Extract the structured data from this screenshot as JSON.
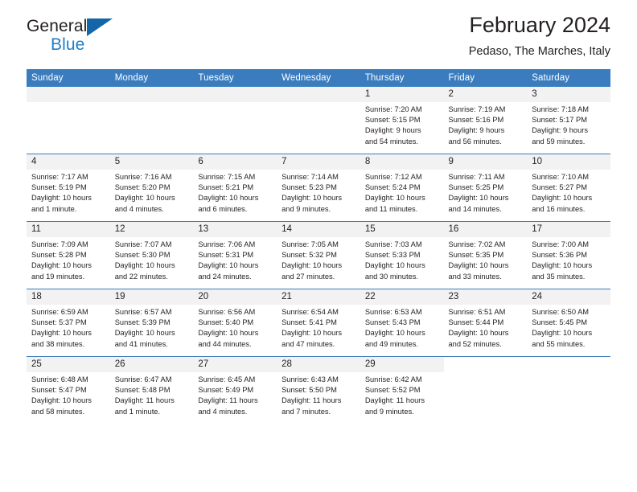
{
  "brand": {
    "name_part1": "General",
    "name_part2": "Blue",
    "triangle_color": "#1566a8",
    "blue_color": "#1f7fc4"
  },
  "header": {
    "title": "February 2024",
    "subtitle": "Pedaso, The Marches, Italy"
  },
  "theme": {
    "header_blue": "#3a7cbe",
    "daynum_gray": "#f2f2f2"
  },
  "weekdays": [
    "Sunday",
    "Monday",
    "Tuesday",
    "Wednesday",
    "Thursday",
    "Friday",
    "Saturday"
  ],
  "weeks": [
    [
      {
        "day": "",
        "empty": true,
        "lines": []
      },
      {
        "day": "",
        "empty": true,
        "lines": []
      },
      {
        "day": "",
        "empty": true,
        "lines": []
      },
      {
        "day": "",
        "empty": true,
        "lines": []
      },
      {
        "day": "1",
        "lines": [
          "Sunrise: 7:20 AM",
          "Sunset: 5:15 PM",
          "Daylight: 9 hours",
          "and 54 minutes."
        ]
      },
      {
        "day": "2",
        "lines": [
          "Sunrise: 7:19 AM",
          "Sunset: 5:16 PM",
          "Daylight: 9 hours",
          "and 56 minutes."
        ]
      },
      {
        "day": "3",
        "lines": [
          "Sunrise: 7:18 AM",
          "Sunset: 5:17 PM",
          "Daylight: 9 hours",
          "and 59 minutes."
        ]
      }
    ],
    [
      {
        "day": "4",
        "lines": [
          "Sunrise: 7:17 AM",
          "Sunset: 5:19 PM",
          "Daylight: 10 hours",
          "and 1 minute."
        ]
      },
      {
        "day": "5",
        "lines": [
          "Sunrise: 7:16 AM",
          "Sunset: 5:20 PM",
          "Daylight: 10 hours",
          "and 4 minutes."
        ]
      },
      {
        "day": "6",
        "lines": [
          "Sunrise: 7:15 AM",
          "Sunset: 5:21 PM",
          "Daylight: 10 hours",
          "and 6 minutes."
        ]
      },
      {
        "day": "7",
        "lines": [
          "Sunrise: 7:14 AM",
          "Sunset: 5:23 PM",
          "Daylight: 10 hours",
          "and 9 minutes."
        ]
      },
      {
        "day": "8",
        "lines": [
          "Sunrise: 7:12 AM",
          "Sunset: 5:24 PM",
          "Daylight: 10 hours",
          "and 11 minutes."
        ]
      },
      {
        "day": "9",
        "lines": [
          "Sunrise: 7:11 AM",
          "Sunset: 5:25 PM",
          "Daylight: 10 hours",
          "and 14 minutes."
        ]
      },
      {
        "day": "10",
        "lines": [
          "Sunrise: 7:10 AM",
          "Sunset: 5:27 PM",
          "Daylight: 10 hours",
          "and 16 minutes."
        ]
      }
    ],
    [
      {
        "day": "11",
        "lines": [
          "Sunrise: 7:09 AM",
          "Sunset: 5:28 PM",
          "Daylight: 10 hours",
          "and 19 minutes."
        ]
      },
      {
        "day": "12",
        "lines": [
          "Sunrise: 7:07 AM",
          "Sunset: 5:30 PM",
          "Daylight: 10 hours",
          "and 22 minutes."
        ]
      },
      {
        "day": "13",
        "lines": [
          "Sunrise: 7:06 AM",
          "Sunset: 5:31 PM",
          "Daylight: 10 hours",
          "and 24 minutes."
        ]
      },
      {
        "day": "14",
        "lines": [
          "Sunrise: 7:05 AM",
          "Sunset: 5:32 PM",
          "Daylight: 10 hours",
          "and 27 minutes."
        ]
      },
      {
        "day": "15",
        "lines": [
          "Sunrise: 7:03 AM",
          "Sunset: 5:33 PM",
          "Daylight: 10 hours",
          "and 30 minutes."
        ]
      },
      {
        "day": "16",
        "lines": [
          "Sunrise: 7:02 AM",
          "Sunset: 5:35 PM",
          "Daylight: 10 hours",
          "and 33 minutes."
        ]
      },
      {
        "day": "17",
        "lines": [
          "Sunrise: 7:00 AM",
          "Sunset: 5:36 PM",
          "Daylight: 10 hours",
          "and 35 minutes."
        ]
      }
    ],
    [
      {
        "day": "18",
        "lines": [
          "Sunrise: 6:59 AM",
          "Sunset: 5:37 PM",
          "Daylight: 10 hours",
          "and 38 minutes."
        ]
      },
      {
        "day": "19",
        "lines": [
          "Sunrise: 6:57 AM",
          "Sunset: 5:39 PM",
          "Daylight: 10 hours",
          "and 41 minutes."
        ]
      },
      {
        "day": "20",
        "lines": [
          "Sunrise: 6:56 AM",
          "Sunset: 5:40 PM",
          "Daylight: 10 hours",
          "and 44 minutes."
        ]
      },
      {
        "day": "21",
        "lines": [
          "Sunrise: 6:54 AM",
          "Sunset: 5:41 PM",
          "Daylight: 10 hours",
          "and 47 minutes."
        ]
      },
      {
        "day": "22",
        "lines": [
          "Sunrise: 6:53 AM",
          "Sunset: 5:43 PM",
          "Daylight: 10 hours",
          "and 49 minutes."
        ]
      },
      {
        "day": "23",
        "lines": [
          "Sunrise: 6:51 AM",
          "Sunset: 5:44 PM",
          "Daylight: 10 hours",
          "and 52 minutes."
        ]
      },
      {
        "day": "24",
        "lines": [
          "Sunrise: 6:50 AM",
          "Sunset: 5:45 PM",
          "Daylight: 10 hours",
          "and 55 minutes."
        ]
      }
    ],
    [
      {
        "day": "25",
        "lines": [
          "Sunrise: 6:48 AM",
          "Sunset: 5:47 PM",
          "Daylight: 10 hours",
          "and 58 minutes."
        ]
      },
      {
        "day": "26",
        "lines": [
          "Sunrise: 6:47 AM",
          "Sunset: 5:48 PM",
          "Daylight: 11 hours",
          "and 1 minute."
        ]
      },
      {
        "day": "27",
        "lines": [
          "Sunrise: 6:45 AM",
          "Sunset: 5:49 PM",
          "Daylight: 11 hours",
          "and 4 minutes."
        ]
      },
      {
        "day": "28",
        "lines": [
          "Sunrise: 6:43 AM",
          "Sunset: 5:50 PM",
          "Daylight: 11 hours",
          "and 7 minutes."
        ]
      },
      {
        "day": "29",
        "lines": [
          "Sunrise: 6:42 AM",
          "Sunset: 5:52 PM",
          "Daylight: 11 hours",
          "and 9 minutes."
        ]
      },
      {
        "day": "",
        "blank": true,
        "lines": []
      },
      {
        "day": "",
        "blank": true,
        "lines": []
      }
    ]
  ]
}
